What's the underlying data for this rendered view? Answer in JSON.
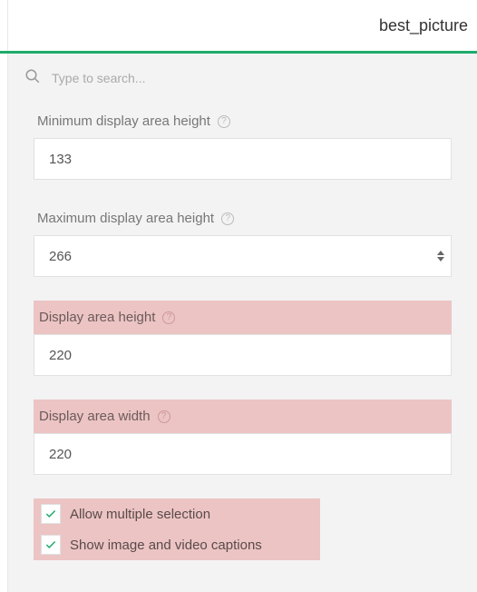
{
  "header": {
    "title": "best_picture"
  },
  "search": {
    "placeholder": "Type to search..."
  },
  "fields": {
    "min_height": {
      "label": "Minimum display area height",
      "value": "133"
    },
    "max_height": {
      "label": "Maximum display area height",
      "value": "266"
    },
    "area_height": {
      "label": "Display area height",
      "value": "220"
    },
    "area_width": {
      "label": "Display area width",
      "value": "220"
    }
  },
  "checks": {
    "multi": {
      "label": "Allow multiple selection",
      "checked": true
    },
    "captions": {
      "label": "Show image and video captions",
      "checked": true
    }
  }
}
